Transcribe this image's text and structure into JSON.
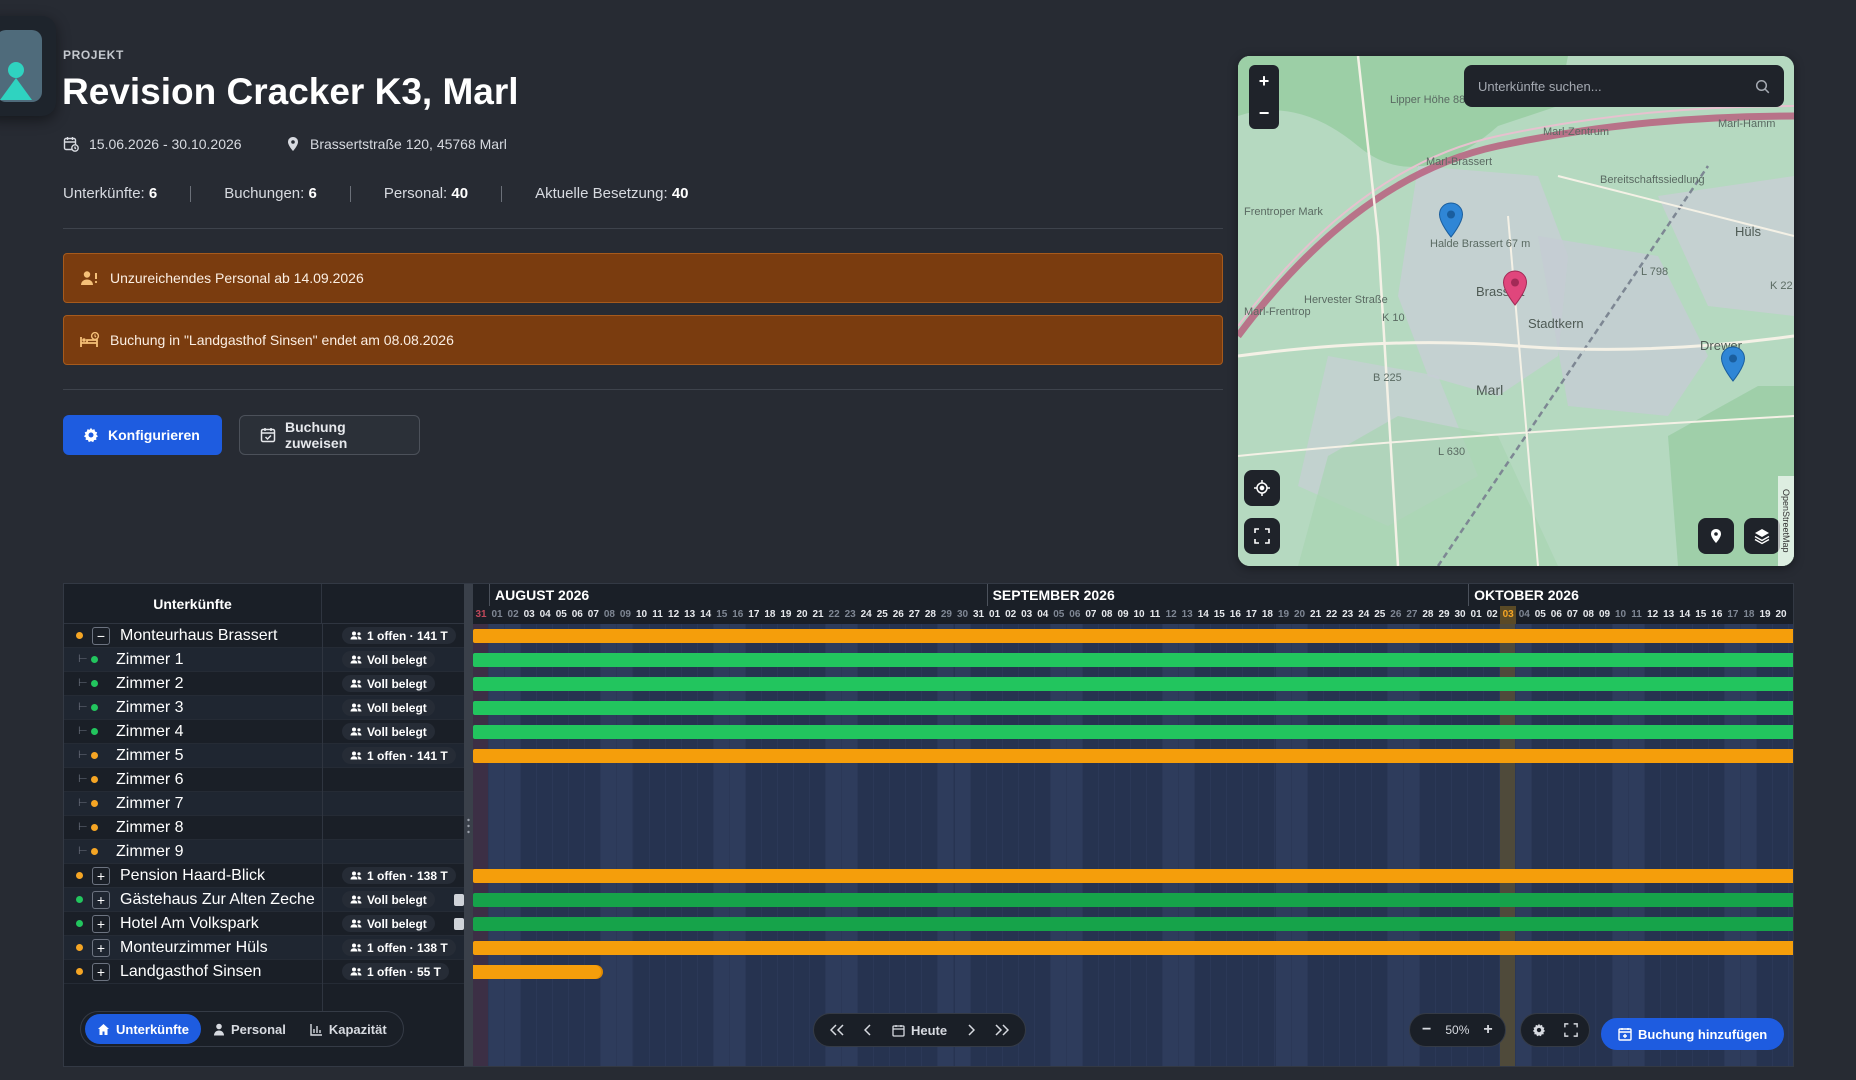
{
  "header": {
    "eyebrow": "PROJEKT",
    "title": "Revision Cracker K3, Marl",
    "date_range": "15.06.2026 - 30.10.2026",
    "address": "Brassertstraße 120, 45768 Marl"
  },
  "stats": [
    {
      "label": "Unterkünfte:",
      "value": "6"
    },
    {
      "label": "Buchungen:",
      "value": "6"
    },
    {
      "label": "Personal:",
      "value": "40"
    },
    {
      "label": "Aktuelle Besetzung:",
      "value": "40"
    }
  ],
  "alerts": [
    {
      "icon": "staff-warning-icon",
      "text": "Unzureichendes Personal ab 14.09.2026"
    },
    {
      "icon": "bed-warning-icon",
      "text": "Buchung in \"Landgasthof Sinsen\" endet am 08.08.2026"
    }
  ],
  "actions": {
    "configure_label": "Konfigurieren",
    "assign_label": "Buchung zuweisen"
  },
  "map": {
    "search_placeholder": "Unterkünfte suchen...",
    "attribution": "OpenStreetMap",
    "labels": [
      "Lipper Höhe 88 m",
      "Brassertstraße",
      "Marl-Brassert",
      "Marl-Zentrum",
      "Marl-Hamm",
      "Frentroper Mark",
      "Halde Brassert 67 m",
      "Brassert",
      "Stadtkern",
      "Hüls",
      "Drewer",
      "Marl-Frentrop",
      "Marl",
      "L 798",
      "K 10",
      "B 225",
      "L 630",
      "K 22",
      "Hervester Straße",
      "Bereitschaftssiedlung"
    ],
    "markers": [
      {
        "name": "map-marker-blue-1",
        "color": "#2f86d6"
      },
      {
        "name": "map-marker-pink",
        "color": "#e0467c"
      },
      {
        "name": "map-marker-blue-2",
        "color": "#2f86d6"
      }
    ]
  },
  "gantt": {
    "left_header": "Unterkünfte",
    "months": [
      "AUGUST 2026",
      "SEPTEMBER 2026",
      "OKTOBER 2026"
    ],
    "rows": [
      {
        "name": "Monteurhaus Brassert",
        "level": 0,
        "toggle": "−",
        "dot": "#f5a524",
        "badge": "1 offen · 141 T",
        "bar": "orange",
        "bar_end_day": 83
      },
      {
        "name": "Zimmer 1",
        "level": 1,
        "dot": "#22c55e",
        "badge": "Voll belegt",
        "bar": "green",
        "bar_end_day": 83
      },
      {
        "name": "Zimmer 2",
        "level": 1,
        "dot": "#22c55e",
        "badge": "Voll belegt",
        "bar": "green",
        "bar_end_day": 83
      },
      {
        "name": "Zimmer 3",
        "level": 1,
        "dot": "#22c55e",
        "badge": "Voll belegt",
        "bar": "green",
        "bar_end_day": 83
      },
      {
        "name": "Zimmer 4",
        "level": 1,
        "dot": "#22c55e",
        "badge": "Voll belegt",
        "bar": "green",
        "bar_end_day": 83
      },
      {
        "name": "Zimmer 5",
        "level": 1,
        "dot": "#f5a524",
        "badge": "1 offen · 141 T",
        "bar": "orange",
        "bar_end_day": 83
      },
      {
        "name": "Zimmer 6",
        "level": 1,
        "dot": "#f5a524",
        "badge": "",
        "bar": "",
        "bar_end_day": 0
      },
      {
        "name": "Zimmer 7",
        "level": 1,
        "dot": "#f5a524",
        "badge": "",
        "bar": "",
        "bar_end_day": 0
      },
      {
        "name": "Zimmer 8",
        "level": 1,
        "dot": "#f5a524",
        "badge": "",
        "bar": "",
        "bar_end_day": 0
      },
      {
        "name": "Zimmer 9",
        "level": 1,
        "dot": "#f5a524",
        "badge": "",
        "bar": "",
        "bar_end_day": 0
      },
      {
        "name": "Pension Haard-Blick",
        "level": 0,
        "toggle": "+",
        "dot": "#f5a524",
        "badge": "1 offen · 138 T",
        "bar": "orange",
        "bar_end_day": 83
      },
      {
        "name": "Gästehaus Zur Alten Zeche",
        "level": 0,
        "toggle": "+",
        "dot": "#22c55e",
        "badge": "Voll belegt",
        "bar": "darkgreen",
        "bar_end_day": 83,
        "mini": true
      },
      {
        "name": "Hotel Am Volkspark",
        "level": 0,
        "toggle": "+",
        "dot": "#22c55e",
        "badge": "Voll belegt",
        "bar": "darkgreen",
        "bar_end_day": 83,
        "mini": true
      },
      {
        "name": "Monteurzimmer Hüls",
        "level": 0,
        "toggle": "+",
        "dot": "#f5a524",
        "badge": "1 offen · 138 T",
        "bar": "orange",
        "bar_end_day": 83
      },
      {
        "name": "Landgasthof Sinsen",
        "level": 0,
        "toggle": "+",
        "dot": "#f5a524",
        "badge": "1 offen · 55 T",
        "bar": "orange",
        "bar_end_day": 8
      }
    ]
  },
  "bottom": {
    "tabs": [
      {
        "label": "Unterkünfte",
        "icon": "home-icon",
        "active": true
      },
      {
        "label": "Personal",
        "icon": "person-icon",
        "active": false
      },
      {
        "label": "Kapazität",
        "icon": "bar-chart-icon",
        "active": false
      }
    ],
    "today_label": "Heute",
    "zoom_label": "50%",
    "add_booking_label": "Buchung hinzufügen"
  }
}
